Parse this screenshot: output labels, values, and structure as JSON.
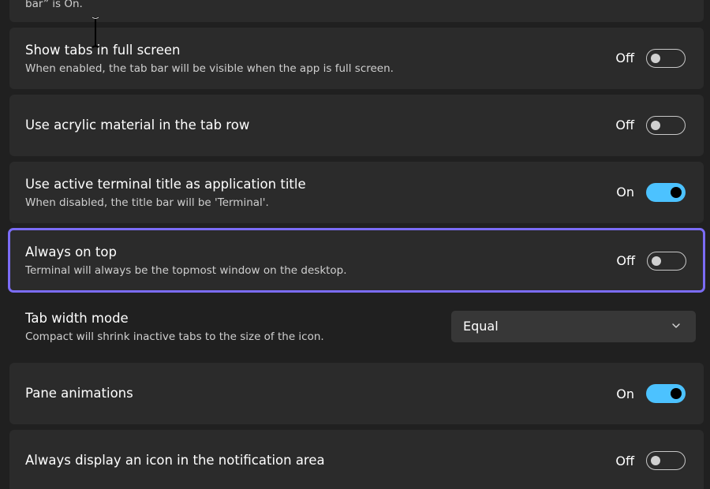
{
  "top_partial": {
    "desc": "bar” is On."
  },
  "settings": [
    {
      "title": "Show tabs in full screen",
      "desc": "When enabled, the tab bar will be visible when the app is full screen.",
      "state": "Off",
      "on": false
    },
    {
      "title": "Use acrylic material in the tab row",
      "desc": "",
      "state": "Off",
      "on": false
    },
    {
      "title": "Use active terminal title as application title",
      "desc": "When disabled, the title bar will be 'Terminal'.",
      "state": "On",
      "on": true
    },
    {
      "title": "Always on top",
      "desc": "Terminal will always be the topmost window on the desktop.",
      "state": "Off",
      "on": false
    },
    {
      "title": "Tab width mode",
      "desc": "Compact will shrink inactive tabs to the size of the icon.",
      "dropdown_value": "Equal"
    },
    {
      "title": "Pane animations",
      "desc": "",
      "state": "On",
      "on": true
    },
    {
      "title": "Always display an icon in the notification area",
      "desc": "",
      "state": "Off",
      "on": false
    }
  ],
  "colors": {
    "accent_toggle_on": "#4cc2ff",
    "focus_border": "#7b6cf6",
    "card_background": "#2b2b2b",
    "page_background": "#202020"
  },
  "icons": {
    "dropdown": "chevron-down-icon",
    "cursor": "text-cursor-icon"
  }
}
